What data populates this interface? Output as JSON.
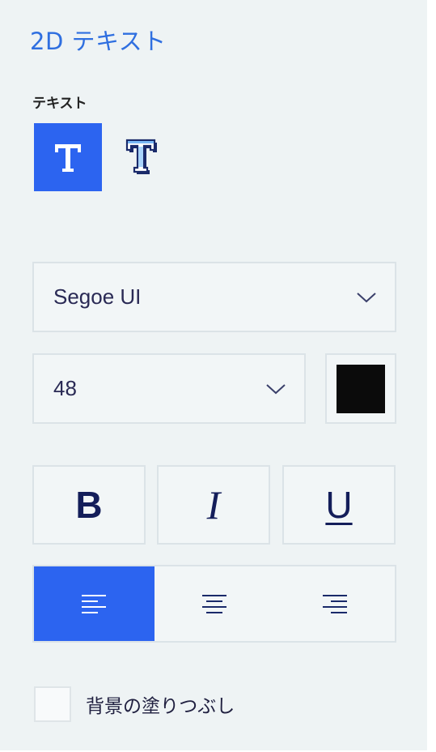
{
  "panel": {
    "title": "2D テキスト",
    "section_label": "テキスト"
  },
  "text_style": {
    "selected": "plain",
    "options": [
      "plain-text-style",
      "3d-text-style"
    ]
  },
  "font": {
    "family_value": "Segoe UI",
    "size_value": "48",
    "color": "#0b0b0b"
  },
  "format": {
    "bold_label": "B",
    "italic_label": "I",
    "underline_label": "U"
  },
  "alignment": {
    "selected": "left",
    "options": [
      "left",
      "center",
      "right"
    ]
  },
  "background_fill": {
    "label": "背景の塗りつぶし",
    "checked": false
  },
  "colors": {
    "accent": "#2c64f0",
    "title": "#2f6fe0",
    "panel_bg": "#eef3f4"
  }
}
